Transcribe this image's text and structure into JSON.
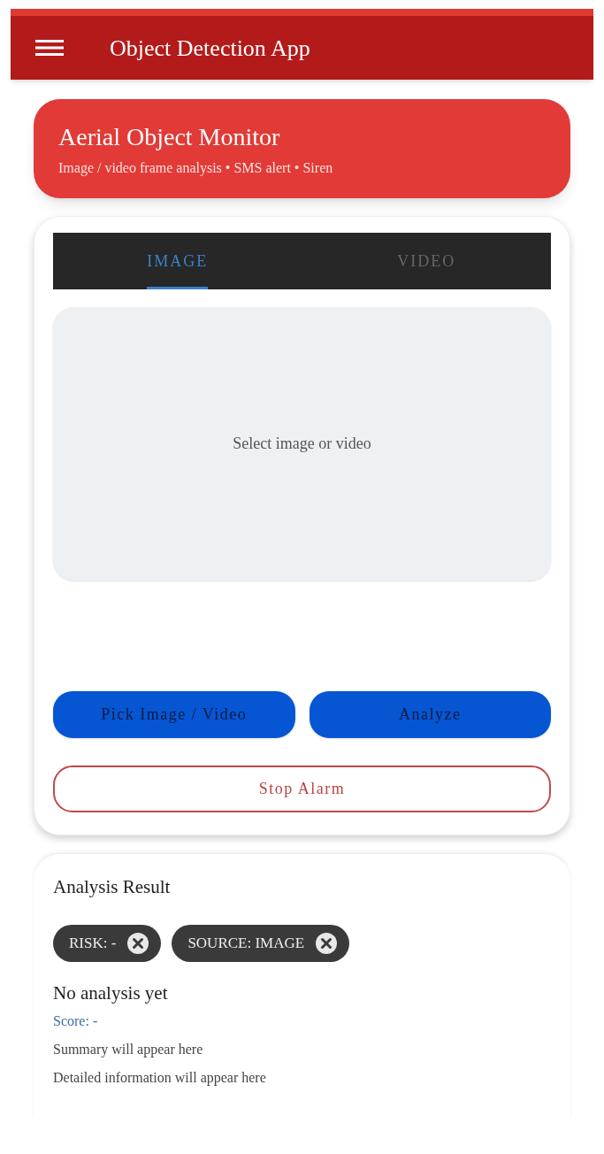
{
  "app_bar": {
    "title": "Object Detection App"
  },
  "header_card": {
    "title": "Aerial Object Monitor",
    "subtitle": "Image / video frame analysis • SMS alert • Siren"
  },
  "tabs": [
    {
      "label": "IMAGE",
      "selected": true
    },
    {
      "label": "VIDEO",
      "selected": false
    }
  ],
  "preview": {
    "placeholder": "Select image or video"
  },
  "buttons": [
    {
      "label": "Pick Image / Video",
      "kind": "filled"
    },
    {
      "label": "Analyze",
      "kind": "filled"
    },
    {
      "label": "Stop Alarm",
      "kind": "outlined"
    }
  ],
  "result": {
    "title": "Analysis Result",
    "chips": [
      {
        "label": "RISK: -"
      },
      {
        "label": "SOURCE: IMAGE"
      }
    ],
    "status": "No analysis yet",
    "score": "Score: -",
    "summary": "Summary will appear here",
    "details": "Detailed information will appear here"
  }
}
